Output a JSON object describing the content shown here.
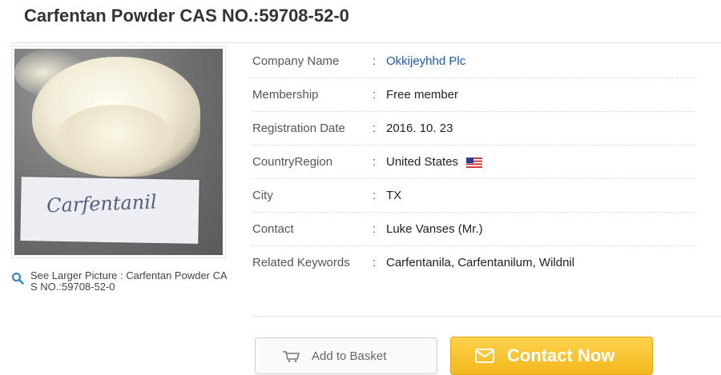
{
  "title": "Carfentan Powder CAS NO.:59708-52-0",
  "product_image": {
    "card_text": "Carfentanil"
  },
  "larger_picture_link": "See Larger Picture : Carfentan Powder CAS NO.:59708-52-0",
  "company_info": {
    "colon": ":",
    "rows": [
      {
        "label": "Company Name",
        "value": "Okkijeyhhd Plc"
      },
      {
        "label": "Membership",
        "value": "Free member"
      },
      {
        "label": "Registration Date",
        "value": "2016. 10. 23"
      },
      {
        "label": "CountryRegion",
        "value": "United States"
      },
      {
        "label": "City",
        "value": "TX"
      },
      {
        "label": "Contact",
        "value": "Luke Vanses (Mr.)"
      },
      {
        "label": "Related Keywords",
        "value": "Carfentanila, Carfentanilum, Wildnil"
      }
    ]
  },
  "buttons": {
    "basket_label": "Add to Basket",
    "contact_label": "Contact Now"
  },
  "icons": {
    "search": "search-icon",
    "flag": "us-flag-icon",
    "basket": "basket-icon",
    "mail": "mail-icon"
  },
  "colors": {
    "link": "#1d5aa8",
    "contact_button": "#f5c02a"
  }
}
